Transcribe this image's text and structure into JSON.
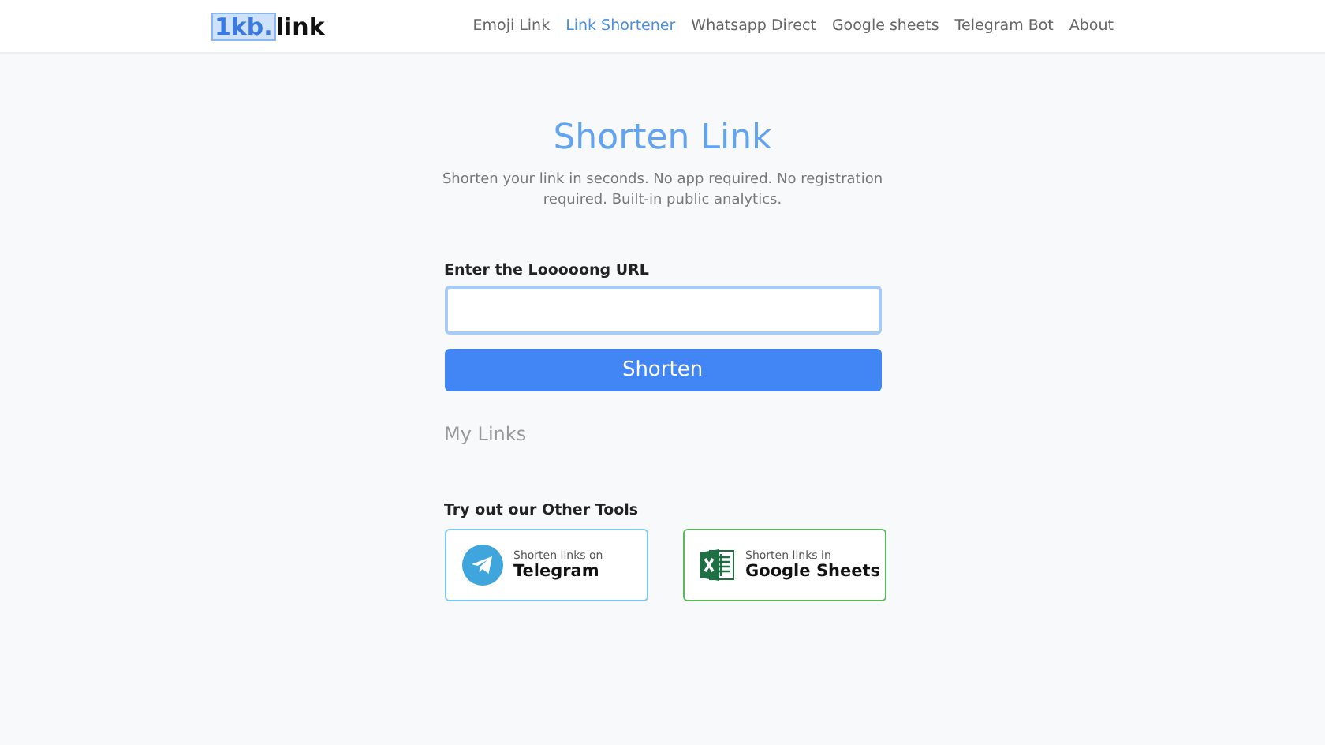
{
  "logo": {
    "mark": "1kb.",
    "text": "link"
  },
  "nav": [
    {
      "label": "Emoji Link",
      "selected": false
    },
    {
      "label": "Link Shortener",
      "selected": true
    },
    {
      "label": "Whatsapp Direct",
      "selected": false
    },
    {
      "label": "Google sheets",
      "selected": false
    },
    {
      "label": "Telegram Bot",
      "selected": false
    },
    {
      "label": "About",
      "selected": false
    }
  ],
  "title": "Shorten Link",
  "subtitle": "Shorten your link in seconds. No app required. No registration required. Built-in public analytics.",
  "url_label": "Enter the Looooong URL",
  "button": "Shorten",
  "my_links": "My Links",
  "tools_heading": "Try out our Other Tools",
  "tools": [
    {
      "kind": "telegram",
      "color": "#7cc8ee",
      "caption": "Shorten links on",
      "name": "Telegram"
    },
    {
      "kind": "sheets",
      "color": "#5cb85c",
      "caption": "Shorten links in",
      "name": "Google Sheets"
    }
  ]
}
